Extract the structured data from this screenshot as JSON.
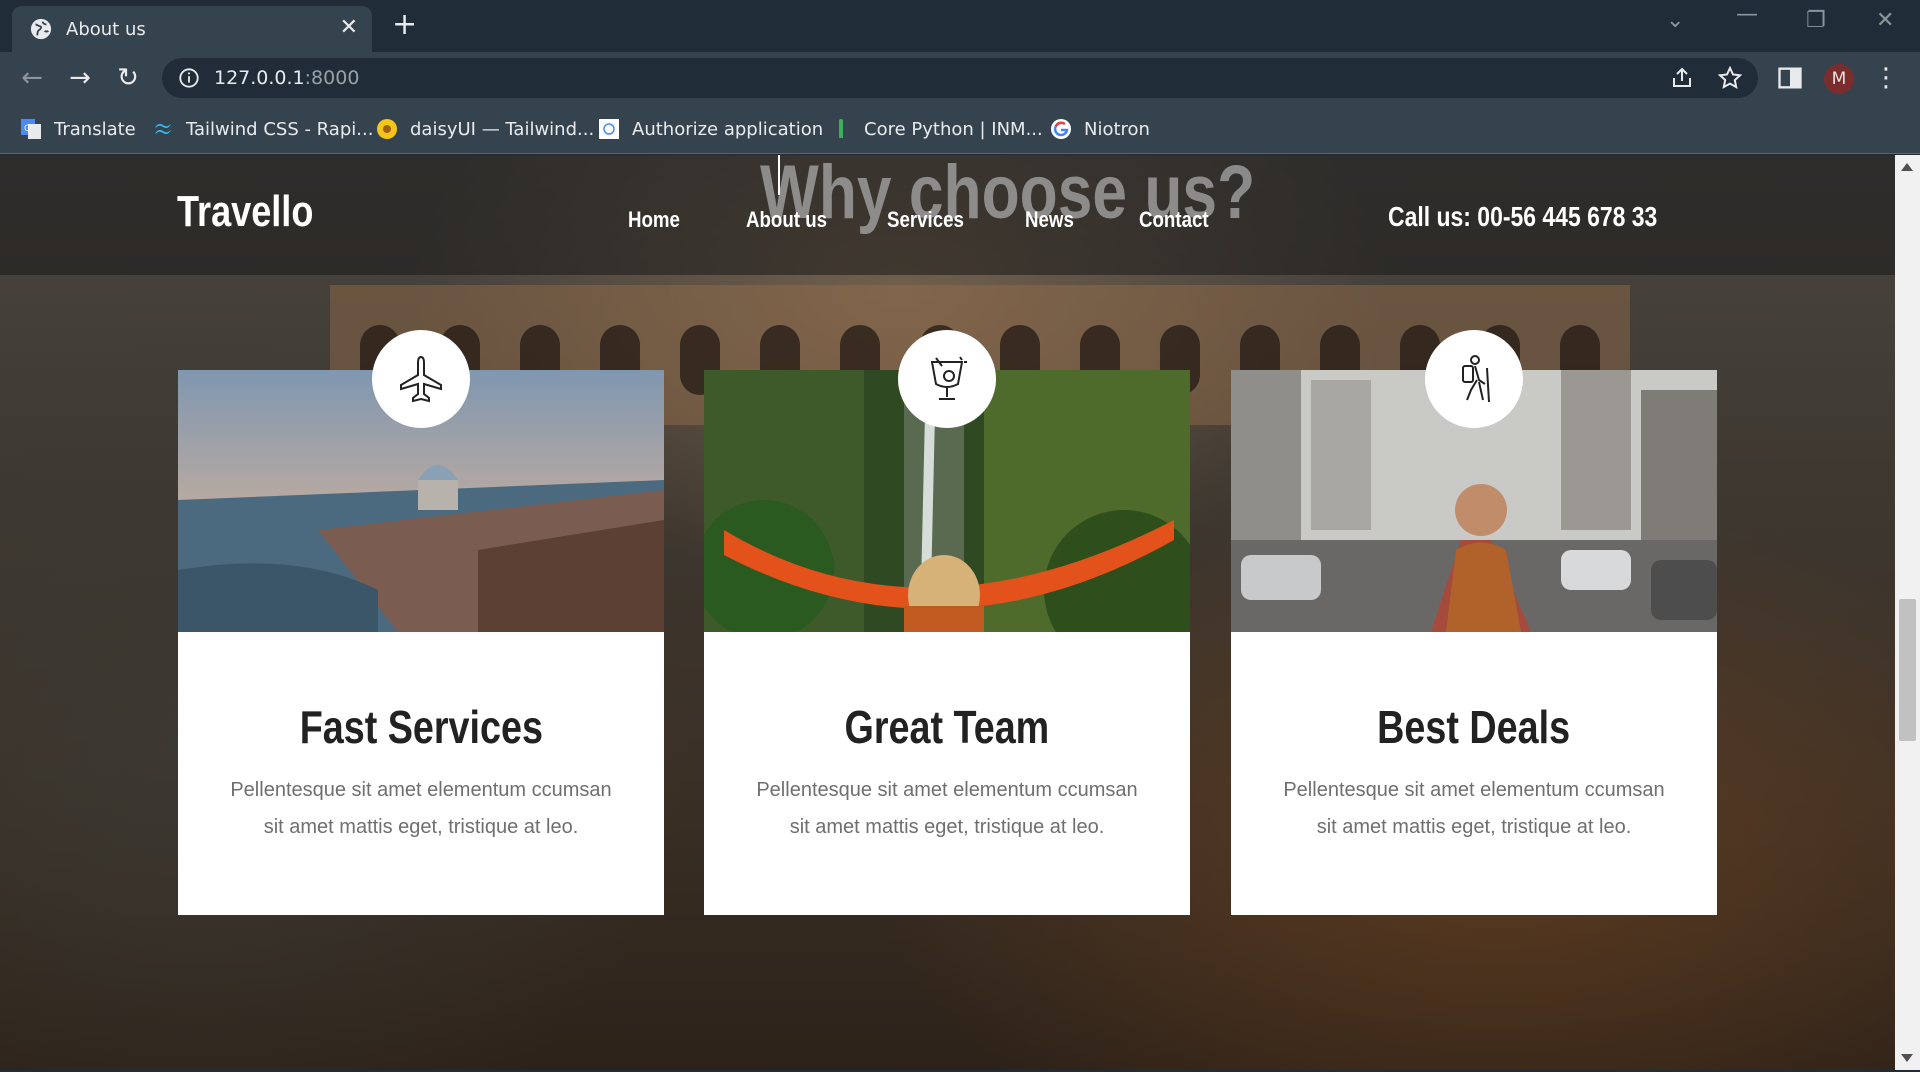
{
  "browser": {
    "tab_title": "About us",
    "url_host": "127.0.0.1",
    "url_port": ":8000",
    "profile_initial": "M",
    "bookmarks": [
      {
        "label": "Translate",
        "icon": "google-translate-icon"
      },
      {
        "label": "Tailwind CSS - Rapi...",
        "icon": "tailwind-icon"
      },
      {
        "label": "daisyUI — Tailwind...",
        "icon": "daisy-flower-icon"
      },
      {
        "label": "Authorize application",
        "icon": "authorize-app-icon"
      },
      {
        "label": "Core Python | INM...",
        "icon": "python-figure-icon"
      },
      {
        "label": "Niotron",
        "icon": "google-g-icon"
      }
    ]
  },
  "site": {
    "logo": "Travello",
    "section_title": "Why choose us?",
    "nav": [
      "Home",
      "About us",
      "Services",
      "News",
      "Contact"
    ],
    "call_us": "Call us: 00-56 445 678 33"
  },
  "cards": [
    {
      "title": "Fast Services",
      "desc": "Pellentesque sit amet elementum ccumsan sit amet mattis eget, tristique at leo.",
      "icon": "airplane-icon",
      "photo": "venice-city-photo"
    },
    {
      "title": "Great Team",
      "desc": "Pellentesque sit amet elementum ccumsan sit amet mattis eget, tristique at leo.",
      "icon": "cocktail-glass-icon",
      "photo": "waterfall-hammock-photo"
    },
    {
      "title": "Best Deals",
      "desc": "Pellentesque sit amet elementum ccumsan sit amet mattis eget, tristique at leo.",
      "icon": "hiker-backpack-icon",
      "photo": "city-street-traveler-photo"
    }
  ]
}
